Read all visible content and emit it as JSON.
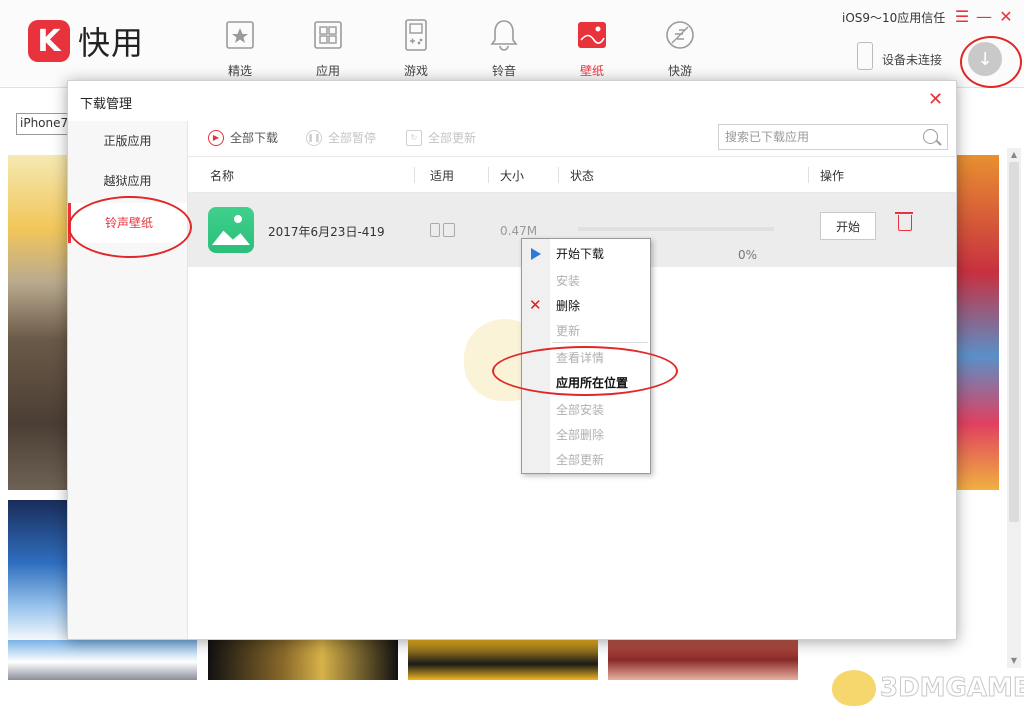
{
  "app": {
    "logo_mark": "K",
    "name": "快用"
  },
  "nav": [
    {
      "label": "精选",
      "icon": "star-icon"
    },
    {
      "label": "应用",
      "icon": "grid-icon"
    },
    {
      "label": "游戏",
      "icon": "gameboy-icon"
    },
    {
      "label": "铃音",
      "icon": "bell-icon"
    },
    {
      "label": "壁纸",
      "icon": "wallpaper-icon",
      "active": true
    },
    {
      "label": "快游",
      "icon": "leaf-icon"
    }
  ],
  "header": {
    "ios_trust": "iOS9～10应用信任",
    "device_status": "设备未连接",
    "window_controls": [
      "☰",
      "—",
      "✕"
    ]
  },
  "background": {
    "device_select": "iPhone7"
  },
  "dialog": {
    "title": "下载管理",
    "close": "✕",
    "sidebar": [
      {
        "label": "正版应用"
      },
      {
        "label": "越狱应用"
      },
      {
        "label": "铃声壁纸",
        "active": true
      }
    ],
    "toolbar": {
      "start_all": "全部下载",
      "pause_all": "全部暂停",
      "update_all": "全部更新",
      "search_placeholder": "搜索已下载应用"
    },
    "columns": {
      "name": "名称",
      "compat": "适用",
      "size": "大小",
      "status": "状态",
      "action": "操作"
    },
    "rows": [
      {
        "name": "2017年6月23日-419",
        "size": "0.47M",
        "progress_text": "0%",
        "progress": 0,
        "action": "开始"
      }
    ]
  },
  "context_menu": {
    "items": [
      {
        "label": "开始下载",
        "enabled": true
      },
      {
        "label": "安装",
        "enabled": false
      },
      {
        "label": "删除",
        "enabled": true
      },
      {
        "label": "更新",
        "enabled": false
      },
      {
        "label": "查看详情",
        "enabled": false
      },
      {
        "label": "应用所在位置",
        "enabled": true
      },
      {
        "label": "全部安装",
        "enabled": false
      },
      {
        "label": "全部删除",
        "enabled": false
      },
      {
        "label": "全部更新",
        "enabled": false
      }
    ]
  },
  "watermark": "3DMGAME",
  "colors": {
    "accent": "#e8323c",
    "annotation": "#e02828"
  }
}
